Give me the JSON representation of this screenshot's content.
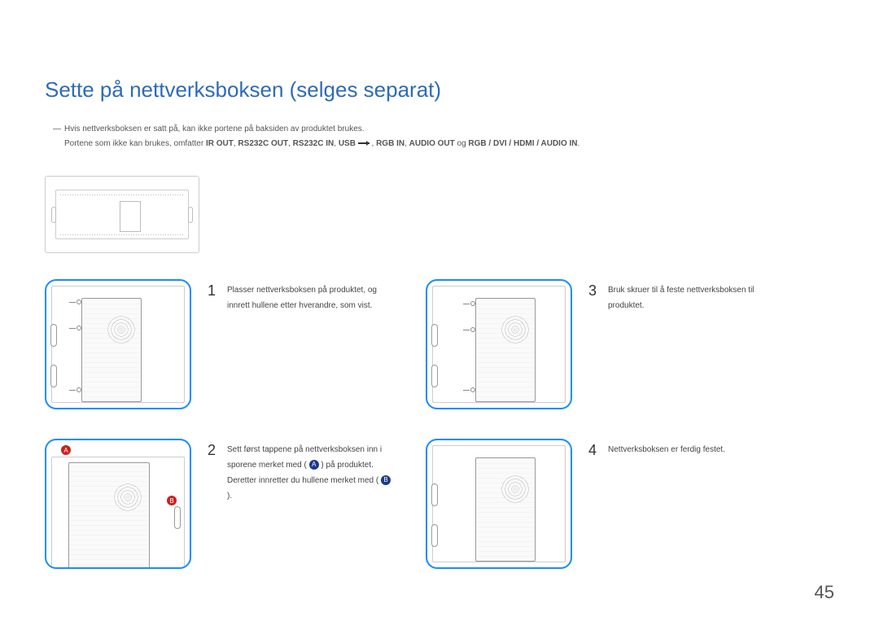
{
  "title": "Sette på nettverksboksen (selges separat)",
  "note": {
    "line1_pre": "Hvis nettverksboksen er satt på, kan ikke portene på baksiden av produktet brukes.",
    "line2_pre": "Portene som ikke kan brukes, omfatter ",
    "b1": "IR OUT",
    "s1": ", ",
    "b2": "RS232C OUT",
    "s2": ", ",
    "b3": "RS232C IN",
    "s3": ", ",
    "b4": "USB ",
    "s4": " , ",
    "b5": "RGB IN",
    "s5": ", ",
    "b6": "AUDIO OUT",
    "s6": " og ",
    "b7": "RGB / DVI / HDMI / AUDIO IN",
    "s7": "."
  },
  "steps": {
    "s1": {
      "num": "1",
      "text": "Plasser nettverksboksen på produktet, og innrett hullene etter hverandre, som vist."
    },
    "s2": {
      "num": "2",
      "t1": "Sett først tappene på nettverksboksen inn i sporene merket med (",
      "ca": "A",
      "t2": ") på produktet. Deretter innretter du hullene merket med (",
      "cb": "B",
      "t3": ")."
    },
    "s3": {
      "num": "3",
      "text": "Bruk skruer til å feste nettverksboksen til produktet."
    },
    "s4": {
      "num": "4",
      "text": "Nettverksboksen er ferdig festet."
    }
  },
  "markers": {
    "A": "A",
    "B": "B"
  },
  "page_number": "45"
}
